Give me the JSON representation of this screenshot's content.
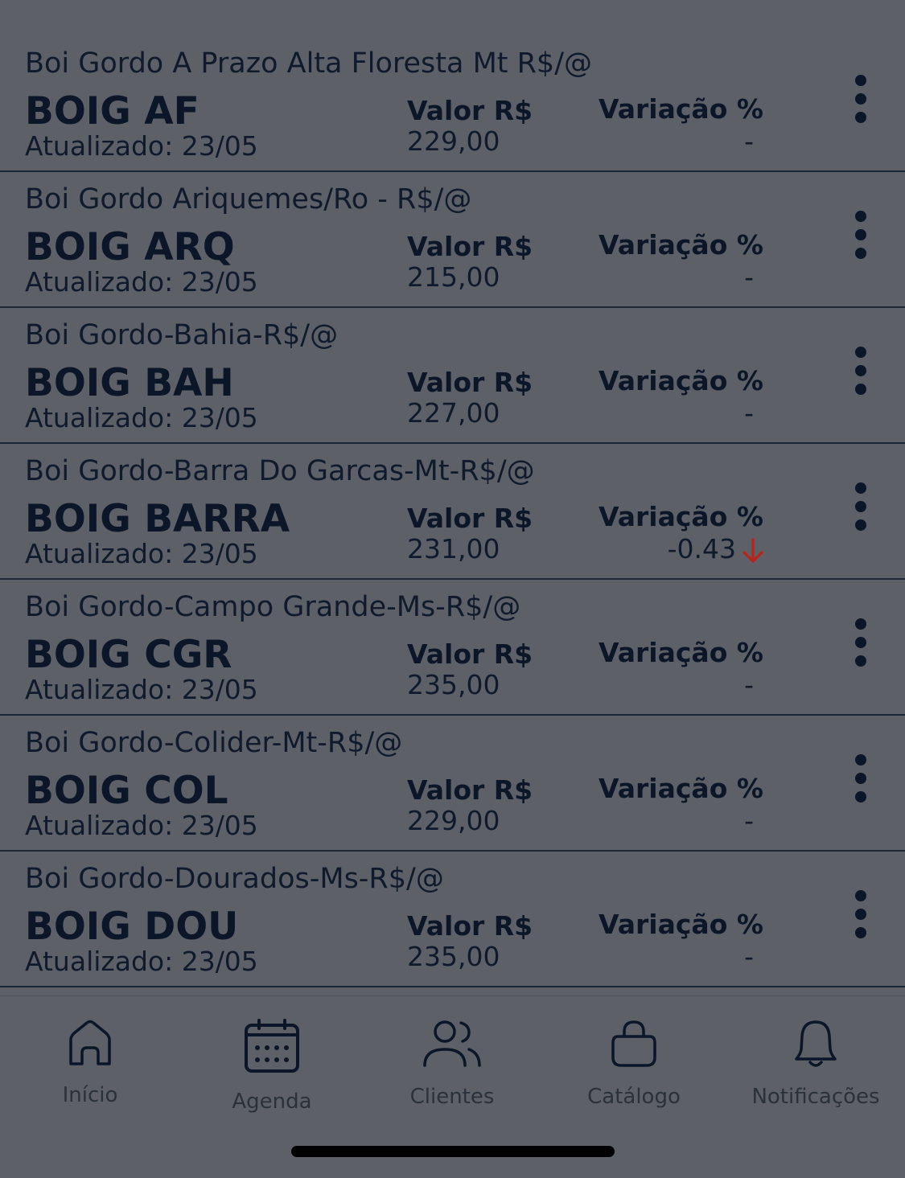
{
  "quotes": [
    {
      "name": "Boi Gordo A Prazo Alta Floresta Mt R$/@",
      "code": "BOIG AF",
      "updated": "Atualizado: 23/05",
      "valor_label": "Valor R$",
      "valor": "229,00",
      "variacao_label": "Variação %",
      "variacao": "-",
      "trend": "none"
    },
    {
      "name": "Boi Gordo Ariquemes/Ro - R$/@",
      "code": "BOIG ARQ",
      "updated": "Atualizado: 23/05",
      "valor_label": "Valor R$",
      "valor": "215,00",
      "variacao_label": "Variação %",
      "variacao": "-",
      "trend": "none"
    },
    {
      "name": "Boi Gordo-Bahia-R$/@",
      "code": "BOIG BAH",
      "updated": "Atualizado: 23/05",
      "valor_label": "Valor R$",
      "valor": "227,00",
      "variacao_label": "Variação %",
      "variacao": "-",
      "trend": "none"
    },
    {
      "name": "Boi Gordo-Barra Do Garcas-Mt-R$/@",
      "code": "BOIG BARRA",
      "updated": "Atualizado: 23/05",
      "valor_label": "Valor R$",
      "valor": "231,00",
      "variacao_label": "Variação %",
      "variacao": "-0.43",
      "trend": "down"
    },
    {
      "name": "Boi Gordo-Campo Grande-Ms-R$/@",
      "code": "BOIG CGR",
      "updated": "Atualizado: 23/05",
      "valor_label": "Valor R$",
      "valor": "235,00",
      "variacao_label": "Variação %",
      "variacao": "-",
      "trend": "none"
    },
    {
      "name": "Boi Gordo-Colider-Mt-R$/@",
      "code": "BOIG COL",
      "updated": "Atualizado: 23/05",
      "valor_label": "Valor R$",
      "valor": "229,00",
      "variacao_label": "Variação %",
      "variacao": "-",
      "trend": "none"
    },
    {
      "name": "Boi Gordo-Dourados-Ms-R$/@",
      "code": "BOIG DOU",
      "updated": "Atualizado: 23/05",
      "valor_label": "Valor R$",
      "valor": "235,00",
      "variacao_label": "Variação %",
      "variacao": "-",
      "trend": "none"
    }
  ],
  "tabbar": {
    "items": [
      {
        "label": "Início",
        "icon": "home-icon"
      },
      {
        "label": "Agenda",
        "icon": "calendar-icon"
      },
      {
        "label": "Clientes",
        "icon": "users-icon"
      },
      {
        "label": "Catálogo",
        "icon": "bag-icon"
      },
      {
        "label": "Notificações",
        "icon": "bell-icon"
      }
    ]
  },
  "colors": {
    "down_arrow": "#b3261e",
    "overlay_bg": "#5d6067",
    "text_dark": "#0b1628"
  }
}
